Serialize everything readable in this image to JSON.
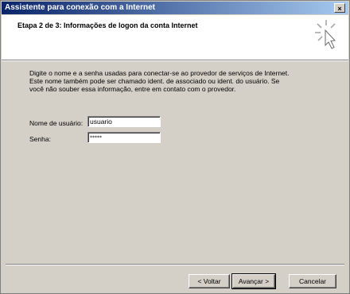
{
  "window": {
    "title": "Assistente para conexão com a Internet",
    "close_glyph": "×"
  },
  "header": {
    "step_title": "Etapa 2 de 3: Informações de logon da conta Internet",
    "icon": "wizard-sparkle-cursor-icon"
  },
  "description": {
    "lines": [
      "Digite o nome e a senha usadas para conectar-se ao  provedor de serviços de Internet.",
      "Este nome também pode ser chamado ident. de associado ou ident. do usuário. Se",
      "você não souber essa informação, entre em contato com o provedor."
    ]
  },
  "form": {
    "username_label": "Nome de usuário:",
    "username_value": "usuario",
    "password_label": "Senha:",
    "password_value": "*****"
  },
  "buttons": {
    "back": "< Voltar",
    "next": "Avançar >",
    "cancel": "Cancelar"
  }
}
